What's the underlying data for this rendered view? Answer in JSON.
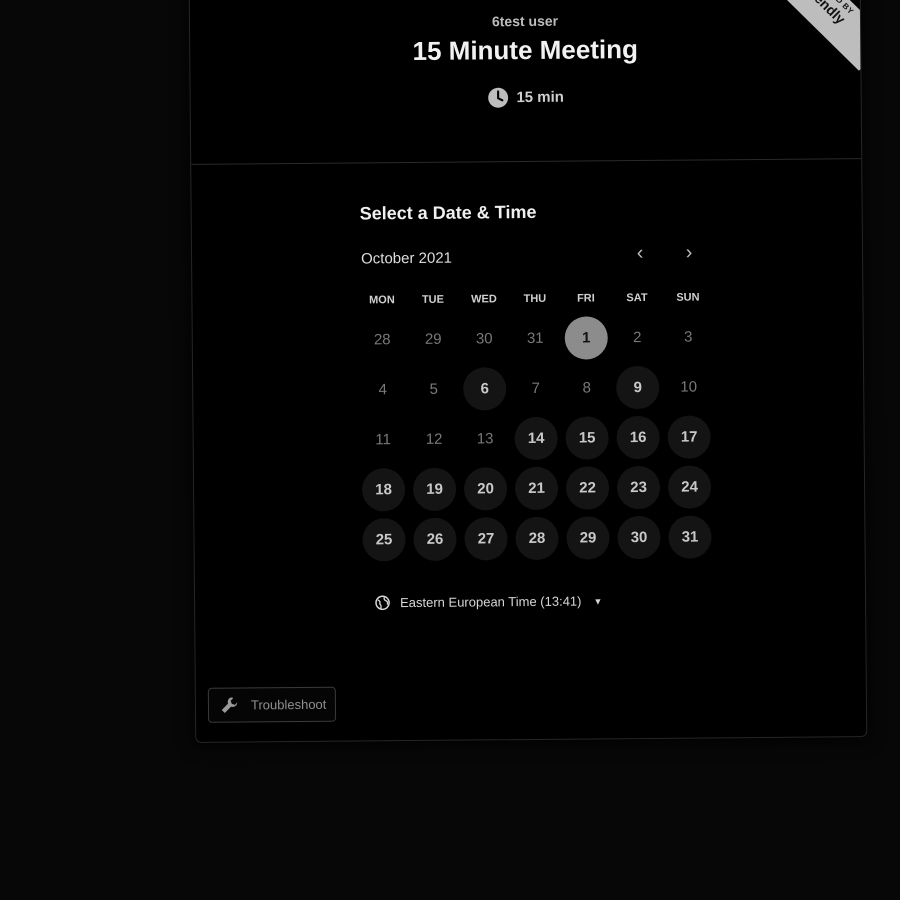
{
  "header": {
    "organizer": "6test user",
    "title": "15 Minute Meeting",
    "duration": "15 min",
    "badge_small": "POWERED BY",
    "badge_brand": "Calendly"
  },
  "calendar": {
    "section_title": "Select a Date & Time",
    "month": "October 2021",
    "weekdays": [
      "MON",
      "TUE",
      "WED",
      "THU",
      "FRI",
      "SAT",
      "SUN"
    ],
    "days": [
      {
        "n": "28",
        "s": "muted"
      },
      {
        "n": "29",
        "s": "muted"
      },
      {
        "n": "30",
        "s": "muted"
      },
      {
        "n": "31",
        "s": "muted"
      },
      {
        "n": "1",
        "s": "selected"
      },
      {
        "n": "2",
        "s": "muted"
      },
      {
        "n": "3",
        "s": "muted"
      },
      {
        "n": "4",
        "s": "muted"
      },
      {
        "n": "5",
        "s": "muted"
      },
      {
        "n": "6",
        "s": "available"
      },
      {
        "n": "7",
        "s": "muted"
      },
      {
        "n": "8",
        "s": "muted"
      },
      {
        "n": "9",
        "s": "available"
      },
      {
        "n": "10",
        "s": "muted"
      },
      {
        "n": "11",
        "s": "muted"
      },
      {
        "n": "12",
        "s": "muted"
      },
      {
        "n": "13",
        "s": "muted"
      },
      {
        "n": "14",
        "s": "available"
      },
      {
        "n": "15",
        "s": "available"
      },
      {
        "n": "16",
        "s": "available"
      },
      {
        "n": "17",
        "s": "available"
      },
      {
        "n": "18",
        "s": "available"
      },
      {
        "n": "19",
        "s": "available"
      },
      {
        "n": "20",
        "s": "available"
      },
      {
        "n": "21",
        "s": "available"
      },
      {
        "n": "22",
        "s": "available"
      },
      {
        "n": "23",
        "s": "available"
      },
      {
        "n": "24",
        "s": "available"
      },
      {
        "n": "25",
        "s": "available"
      },
      {
        "n": "26",
        "s": "available"
      },
      {
        "n": "27",
        "s": "available"
      },
      {
        "n": "28",
        "s": "available"
      },
      {
        "n": "29",
        "s": "available"
      },
      {
        "n": "30",
        "s": "available"
      },
      {
        "n": "31",
        "s": "available"
      }
    ]
  },
  "timezone": {
    "label": "Eastern European Time (13:41)"
  },
  "footer": {
    "troubleshoot_label": "Troubleshoot"
  },
  "colors": {
    "background": "#070707",
    "card": "#000000",
    "selected": "#8c8c8c",
    "available": "#141414"
  },
  "icons": [
    "clock-icon",
    "chevron-left-icon",
    "chevron-right-icon",
    "globe-icon",
    "caret-down-icon",
    "wrench-icon"
  ]
}
